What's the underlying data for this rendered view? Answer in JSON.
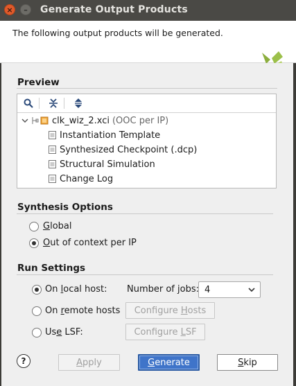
{
  "window": {
    "title": "Generate Output Products",
    "close_glyph": "×",
    "minimize_glyph": "–"
  },
  "header": {
    "text": "The following output products will be generated.",
    "logo_icon": "vivado-logo-icon"
  },
  "preview": {
    "title": "Preview",
    "toolbar_icons": [
      "search-icon",
      "collapse-all-icon",
      "expand-all-icon"
    ],
    "root": {
      "name": "clk_wiz_2.xci",
      "suffix": "(OOC per IP)"
    },
    "children": [
      {
        "label": "Instantiation Template"
      },
      {
        "label": "Synthesized Checkpoint (.dcp)"
      },
      {
        "label": "Structural Simulation"
      },
      {
        "label": "Change Log"
      }
    ]
  },
  "synthesis": {
    "title": "Synthesis Options",
    "global_label": "Global",
    "ooc_label": "Out of context per IP",
    "selected": "ooc"
  },
  "run": {
    "title": "Run Settings",
    "local_label": "On local host:",
    "remote_label": "On remote hosts",
    "lsf_label": "Use LSF:",
    "selected": "local",
    "jobs_label": "Number of jobs:",
    "jobs_value": "4",
    "configure_hosts": "Configure Hosts",
    "configure_lsf": "Configure LSF"
  },
  "footer": {
    "help": "?",
    "apply": "Apply",
    "generate": "Generate",
    "skip": "Skip"
  },
  "colors": {
    "accent": "#3f74c9",
    "logo_green": "#8cae3e",
    "title_bar": "#4a4945",
    "close_button": "#e05a2b"
  }
}
